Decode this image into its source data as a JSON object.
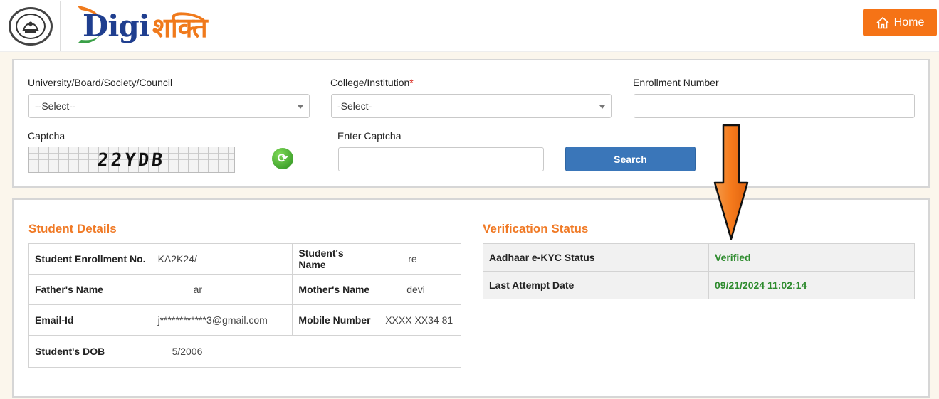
{
  "header": {
    "logo_text_latin": "Digi",
    "logo_text_hindi": "शक्ति",
    "home_label": "Home",
    "home_icon": "home-icon"
  },
  "search_form": {
    "university_label": "University/Board/Society/Council",
    "university_selected": "--Select--",
    "college_label": "College/Institution",
    "college_required_mark": "*",
    "college_selected": "-Select-",
    "enrollment_label": "Enrollment Number",
    "enrollment_value": "",
    "captcha_label": "Captcha",
    "captcha_text": "22YDB",
    "refresh_icon": "refresh-icon",
    "enter_captcha_label": "Enter Captcha",
    "enter_captcha_value": "",
    "search_label": "Search"
  },
  "student_details": {
    "title": "Student Details",
    "rows": [
      {
        "k1": "Student Enrollment No.",
        "v1": "KA2K24/",
        "k2": "Student's Name",
        "v2": "re"
      },
      {
        "k1": "Father's Name",
        "v1": "ar",
        "k2": "Mother's Name",
        "v2": "devi"
      },
      {
        "k1": "Email-Id",
        "v1": "j************3@gmail.com",
        "k2": "Mobile Number",
        "v2": "XXXX XX34 81"
      },
      {
        "k1": "Student's DOB",
        "v1": "5/2006"
      }
    ]
  },
  "verification_status": {
    "title": "Verification Status",
    "rows": [
      {
        "k": "Aadhaar e-KYC Status",
        "v": "Verified"
      },
      {
        "k": "Last Attempt Date",
        "v": "09/21/2024 11:02:14"
      }
    ]
  },
  "colors": {
    "accent_orange": "#f57316",
    "search_blue": "#3a76b9",
    "verified_green": "#2e8b2e",
    "logo_blue": "#1f3e8f"
  }
}
